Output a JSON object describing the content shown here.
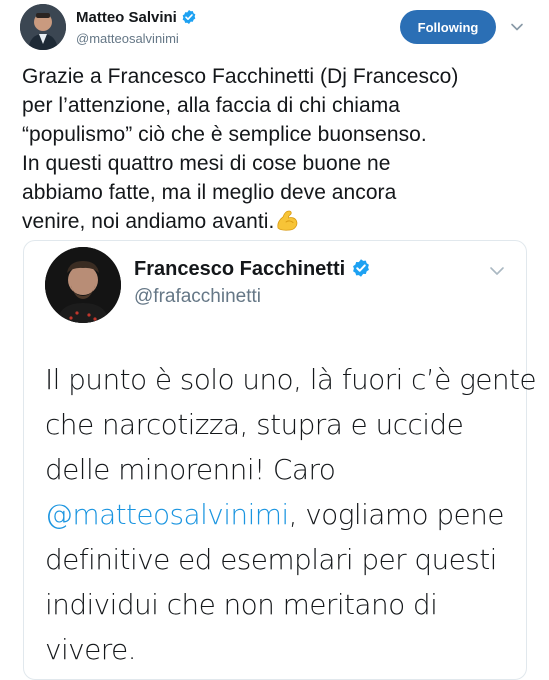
{
  "tweet": {
    "author_name": "Matteo Salvini",
    "author_handle": "@matteosalvinimi",
    "follow_label": "Following",
    "text_lines": [
      "Grazie a Francesco Facchinetti (Dj Francesco)",
      "per l’attenzione, alla faccia di chi chiama",
      "“populismo” ciò che è semplice buonsenso.",
      "In questi quattro mesi di cose buone ne",
      "abbiamo fatte, ma il meglio deve ancora",
      "venire, noi andiamo avanti."
    ],
    "emoji": "flexed-biceps-emoji"
  },
  "quoted": {
    "author_name": "Francesco Facchinetti",
    "author_handle": "@frafacchinetti",
    "line_1": "Il punto è solo uno, là fuori c’è gente",
    "line_2": "che narcotizza, stupra e uccide",
    "line_3": "delle minorenni! Caro",
    "mention": "@matteosalvinimi",
    "line_4_rest": ", vogliamo pene",
    "line_5": "definitive ed esemplari per questi",
    "line_6": "individui che non meritano di",
    "line_7": "vivere."
  },
  "colors": {
    "follow_button": "#2b6fb5",
    "verified": "#1da1f2",
    "mention": "#1b95e0",
    "handle": "#657786"
  }
}
